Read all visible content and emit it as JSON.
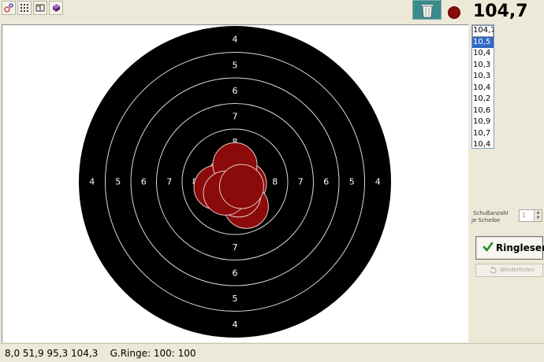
{
  "toolbar": {
    "buttons": [
      {
        "icon": "target-settings-icon"
      },
      {
        "icon": "grid-dots-icon"
      },
      {
        "icon": "book-icon"
      },
      {
        "icon": "dice-icon"
      }
    ],
    "trash_icon": "trash-bin-icon",
    "status_color": "#8b0a0a"
  },
  "target": {
    "ring_labels_vertical_top": [
      "4",
      "5",
      "6",
      "7",
      "8"
    ],
    "ring_labels_vertical_bottom": [
      "8",
      "7",
      "6",
      "5",
      "4"
    ],
    "ring_labels_horizontal_left": [
      "4",
      "5",
      "6",
      "7",
      "8"
    ],
    "ring_labels_horizontal_right": [
      "8",
      "7",
      "6",
      "5",
      "4"
    ],
    "shot_color": "#8b0a0a",
    "shots": [
      {
        "dx": -0.3,
        "dy": -0.2
      },
      {
        "dx": 0.5,
        "dy": 0.1
      },
      {
        "dx": -0.1,
        "dy": 0.5
      },
      {
        "dx": 0.6,
        "dy": 1.3
      },
      {
        "dx": 0.05,
        "dy": 0.05
      },
      {
        "dx": -1.0,
        "dy": 0.3
      },
      {
        "dx": 0.2,
        "dy": 0.7
      },
      {
        "dx": 0.0,
        "dy": -0.9
      },
      {
        "dx": -0.5,
        "dy": 0.6
      },
      {
        "dx": 0.35,
        "dy": 0.25
      }
    ]
  },
  "panel": {
    "total": "104,7",
    "shot_values": [
      "104,7",
      "10,5",
      "10,4",
      "10,3",
      "10,3",
      "10,4",
      "10,2",
      "10,6",
      "10,9",
      "10,7",
      "10,4"
    ],
    "selected_index": 1,
    "shot_count_label": "Schußanzahl",
    "per_target_label": "je Scheibe",
    "shot_count_value": "1",
    "read_button": "Ringlesen",
    "repeat_button": "Wiederholen"
  },
  "status": {
    "text": "8,0 51,9 95,3 104,3    G.Ringe: 100: 100"
  }
}
